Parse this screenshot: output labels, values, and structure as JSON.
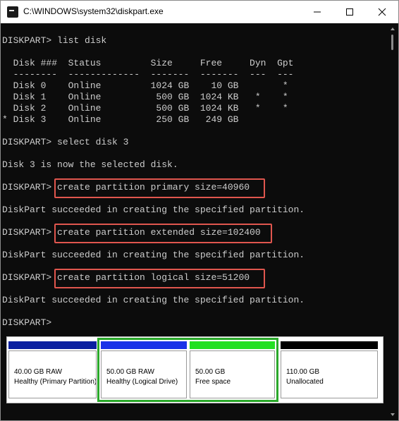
{
  "window": {
    "title": "C:\\WINDOWS\\system32\\diskpart.exe",
    "controls": [
      "minimize",
      "maximize",
      "close"
    ]
  },
  "console": {
    "lines": [
      "DISKPART> list disk",
      "",
      "  Disk ###  Status         Size     Free     Dyn  Gpt",
      "  --------  -------------  -------  -------  ---  ---",
      "  Disk 0    Online         1024 GB    10 GB        *",
      "  Disk 1    Online          500 GB  1024 KB   *    *",
      "  Disk 2    Online          500 GB  1024 KB   *    *",
      "* Disk 3    Online          250 GB   249 GB",
      "",
      "DISKPART> select disk 3",
      "",
      "Disk 3 is now the selected disk.",
      "",
      "DISKPART> create partition primary size=40960",
      "",
      "DiskPart succeeded in creating the specified partition.",
      "",
      "DISKPART> create partition extended size=102400",
      "",
      "DiskPart succeeded in creating the specified partition.",
      "",
      "DISKPART> create partition logical size=51200",
      "",
      "DiskPart succeeded in creating the specified partition.",
      "",
      "DISKPART>"
    ]
  },
  "disk_map": {
    "segments": [
      {
        "size": "40.00 GB RAW",
        "status": "Healthy (Primary Partition)",
        "bar_color": "#0a1fa0"
      },
      {
        "size": "50.00 GB RAW",
        "status": "Healthy (Logical Drive)",
        "bar_color": "#1a32e8"
      },
      {
        "size": "50.00 GB",
        "status": "Free space",
        "bar_color": "#22e022"
      },
      {
        "size": "110.00 GB",
        "status": "Unallocated",
        "bar_color": "#000000"
      }
    ],
    "extended_frame_color": "#2aa82a"
  },
  "colors": {
    "console_bg": "#0c0c0c",
    "console_text": "#cccccc",
    "highlight": "#e0564e"
  }
}
